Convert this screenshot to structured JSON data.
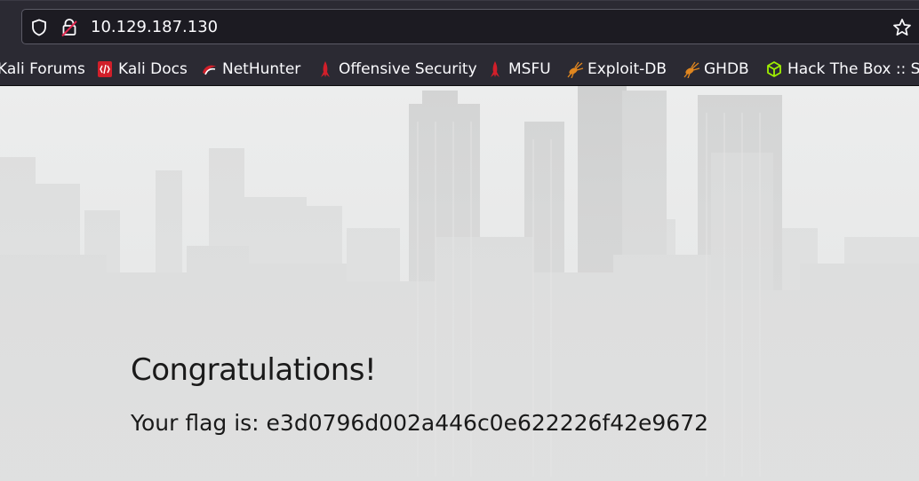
{
  "browser": {
    "url": "10.129.187.130",
    "icons": {
      "security": "shield-icon",
      "connection": "lock-icon",
      "bookmark": "star-icon"
    }
  },
  "bookmarks": [
    {
      "label": "Kali Forums",
      "icon": "kali-forums-icon"
    },
    {
      "label": "Kali Docs",
      "icon": "kali-docs-icon"
    },
    {
      "label": "NetHunter",
      "icon": "nethunter-icon"
    },
    {
      "label": "Offensive Security",
      "icon": "offensive-security-icon"
    },
    {
      "label": "MSFU",
      "icon": "msfu-icon"
    },
    {
      "label": "Exploit-DB",
      "icon": "exploit-db-icon"
    },
    {
      "label": "GHDB",
      "icon": "ghdb-icon"
    },
    {
      "label": "Hack The Box :: St",
      "icon": "hack-the-box-icon"
    }
  ],
  "page": {
    "heading": "Congratulations!",
    "flag_text": "Your flag is: e3d0796d002a446c0e622226f42e9672"
  },
  "colors": {
    "toolbar": "#2b2a33",
    "urlbar": "#1c1b22",
    "text_light": "#fbfbfe",
    "page_background": "#e8e9e9",
    "page_text": "#1a1a1a",
    "offsec_red": "#d11f2a",
    "exploit_orange": "#e0861f",
    "htb_green": "#9fef00"
  }
}
